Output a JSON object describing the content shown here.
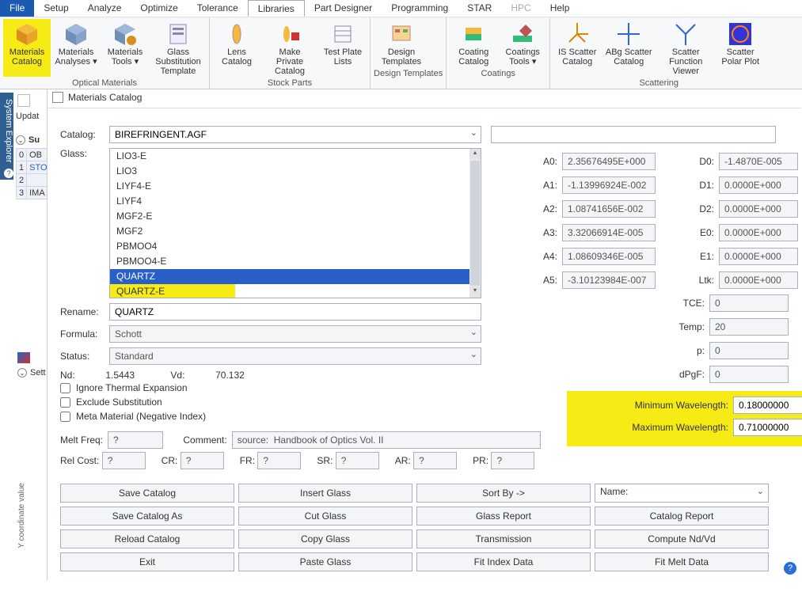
{
  "menubar": {
    "file": "File",
    "items": [
      "Setup",
      "Analyze",
      "Optimize",
      "Tolerance",
      "Libraries",
      "Part Designer",
      "Programming",
      "STAR",
      "HPC",
      "Help"
    ],
    "active_index": 4
  },
  "ribbon": {
    "groups": [
      {
        "label": "Optical Materials",
        "buttons": [
          {
            "label": "Materials Catalog",
            "highlight": true,
            "icon": "cube-icon"
          },
          {
            "label": "Materials Analyses ▾",
            "icon": "cube-analyze-icon"
          },
          {
            "label": "Materials Tools ▾",
            "icon": "cube-tools-icon"
          },
          {
            "label": "Glass Substitution Template",
            "icon": "template-icon"
          }
        ]
      },
      {
        "label": "Stock Parts",
        "buttons": [
          {
            "label": "Lens Catalog",
            "icon": "lens-icon"
          },
          {
            "label": "Make Private Catalog",
            "icon": "private-icon"
          },
          {
            "label": "Test Plate Lists",
            "icon": "testplate-icon"
          }
        ]
      },
      {
        "label": "Design Templates",
        "buttons": [
          {
            "label": "Design Templates",
            "icon": "design-template-icon"
          }
        ]
      },
      {
        "label": "Coatings",
        "buttons": [
          {
            "label": "Coating Catalog",
            "icon": "coating-icon"
          },
          {
            "label": "Coatings Tools ▾",
            "icon": "coating-tools-icon"
          }
        ]
      },
      {
        "label": "Scattering",
        "buttons": [
          {
            "label": "IS Scatter Catalog",
            "icon": "scatter-is-icon"
          },
          {
            "label": "ABg Scatter Catalog",
            "icon": "scatter-abg-icon"
          },
          {
            "label": "Scatter Function Viewer",
            "icon": "scatter-fn-icon"
          },
          {
            "label": "Scatter Polar Plot",
            "icon": "scatter-polar-icon"
          }
        ]
      }
    ]
  },
  "left_panel": {
    "vtab": "System Explorer",
    "update_label": "Updat",
    "su_label": "Su",
    "rows": [
      {
        "idx": "0",
        "val": "OB"
      },
      {
        "idx": "1",
        "val": "STO"
      },
      {
        "idx": "2",
        "val": ""
      },
      {
        "idx": "3",
        "val": "IMA"
      }
    ],
    "sett_label": "Sett",
    "yaxis": "Y coordinate value"
  },
  "dialog": {
    "title": "Materials Catalog",
    "catalog_label": "Catalog:",
    "catalog_value": "BIREFRINGENT.AGF",
    "glass_label": "Glass:",
    "glass_items": [
      "LIO3-E",
      "LIO3",
      "LIYF4-E",
      "LIYF4",
      "MGF2-E",
      "MGF2",
      "PBMOO4",
      "PBMOO4-E",
      "QUARTZ",
      "QUARTZ-E"
    ],
    "glass_selected_index": 8,
    "rename_label": "Rename:",
    "rename_value": "QUARTZ",
    "formula_label": "Formula:",
    "formula_value": "Schott",
    "status_label": "Status:",
    "status_value": "Standard",
    "nd_label": "Nd:",
    "nd_value": "1.5443",
    "vd_label": "Vd:",
    "vd_value": "70.132",
    "cb1": "Ignore Thermal Expansion",
    "cb2": "Exclude Substitution",
    "cb3": "Meta Material (Negative Index)",
    "meltfreq_label": "Melt Freq:",
    "meltfreq_value": "?",
    "comment_label": "Comment:",
    "comment_value": "source:  Handbook of Optics Vol. II",
    "relcost_label": "Rel Cost:",
    "relcost_value": "?",
    "cr_label": "CR:",
    "cr_value": "?",
    "fr_label": "FR:",
    "fr_value": "?",
    "sr_label": "SR:",
    "sr_value": "?",
    "ar_label": "AR:",
    "ar_value": "?",
    "pr_label": "PR:",
    "pr_value": "?",
    "coeff_a": [
      {
        "l": "A0:",
        "v": "2.35676495E+000"
      },
      {
        "l": "A1:",
        "v": "-1.13996924E-002"
      },
      {
        "l": "A2:",
        "v": "1.08741656E-002"
      },
      {
        "l": "A3:",
        "v": "3.32066914E-005"
      },
      {
        "l": "A4:",
        "v": "1.08609346E-005"
      },
      {
        "l": "A5:",
        "v": "-3.10123984E-007"
      }
    ],
    "coeff_d": [
      {
        "l": "D0:",
        "v": "-1.4870E-005"
      },
      {
        "l": "D1:",
        "v": "0.0000E+000"
      },
      {
        "l": "D2:",
        "v": "0.0000E+000"
      },
      {
        "l": "E0:",
        "v": "0.0000E+000"
      },
      {
        "l": "E1:",
        "v": "0.0000E+000"
      },
      {
        "l": "Ltk:",
        "v": "0.0000E+000"
      }
    ],
    "extra": [
      {
        "l": "TCE:",
        "v": "0"
      },
      {
        "l": "Temp:",
        "v": "20"
      },
      {
        "l": "p:",
        "v": "0"
      },
      {
        "l": "dPgF:",
        "v": "0"
      }
    ],
    "minwl_label": "Minimum Wavelength:",
    "minwl_value": "0.18000000",
    "maxwl_label": "Maximum Wavelength:",
    "maxwl_value": "0.71000000",
    "buttons": {
      "r1": [
        "Save Catalog",
        "Insert Glass",
        "Sort By ->"
      ],
      "name_label": "Name:",
      "r2": [
        "Save Catalog As",
        "Cut Glass",
        "Glass Report",
        "Catalog Report"
      ],
      "r3": [
        "Reload Catalog",
        "Copy Glass",
        "Transmission",
        "Compute Nd/Vd"
      ],
      "r4": [
        "Exit",
        "Paste Glass",
        "Fit Index Data",
        "Fit Melt Data"
      ]
    }
  }
}
